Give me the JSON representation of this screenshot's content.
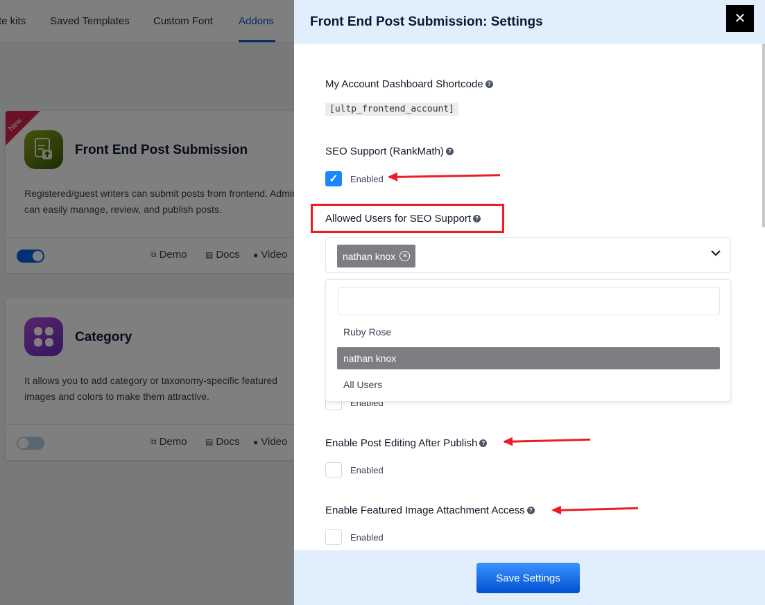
{
  "nav": {
    "tabs": [
      {
        "label": "te kits",
        "active": false
      },
      {
        "label": "Saved Templates",
        "active": false
      },
      {
        "label": "Custom Font",
        "active": false
      },
      {
        "label": "Addons",
        "active": true
      }
    ]
  },
  "addons": [
    {
      "badge": "New",
      "title": "Front End Post Submission",
      "description": "Registered/guest writers can submit posts from frontend. Admins can easily manage, review, and publish posts.",
      "enabled": true,
      "links": {
        "demo": "Demo",
        "docs": "Docs",
        "video": "Video"
      }
    },
    {
      "title": "Category",
      "description": "It allows you to add category or taxonomy-specific featured images and colors to make them attractive.",
      "enabled": false,
      "links": {
        "demo": "Demo",
        "docs": "Docs",
        "video": "Video"
      }
    }
  ],
  "drawer": {
    "title": "Front End Post Submission: Settings",
    "close_label": "✕",
    "fields": {
      "shortcode": {
        "label": "My Account Dashboard Shortcode",
        "value": "[ultp_frontend_account]"
      },
      "seo_support": {
        "label": "SEO Support (RankMath)",
        "checkbox_label": "Enabled",
        "checked": true
      },
      "allowed_users": {
        "label": "Allowed Users for SEO Support",
        "selected": [
          "nathan knox"
        ],
        "search_value": "",
        "options": [
          "Ruby Rose",
          "nathan knox",
          "All Users"
        ],
        "highlighted_option": "nathan knox"
      },
      "hidden_field": {
        "checkbox_label": "Enabled",
        "checked": false
      },
      "post_editing": {
        "label": "Enable Post Editing After Publish",
        "checkbox_label": "Enabled",
        "checked": false
      },
      "featured_image": {
        "label": "Enable Featured Image Attachment Access",
        "checkbox_label": "Enabled",
        "checked": false
      }
    },
    "save_label": "Save Settings"
  },
  "colors": {
    "accent": "#0a58ca",
    "annotation": "#ed1c24",
    "checkbox_checked": "#1a86ff",
    "drawer_header": "#e1effd"
  }
}
